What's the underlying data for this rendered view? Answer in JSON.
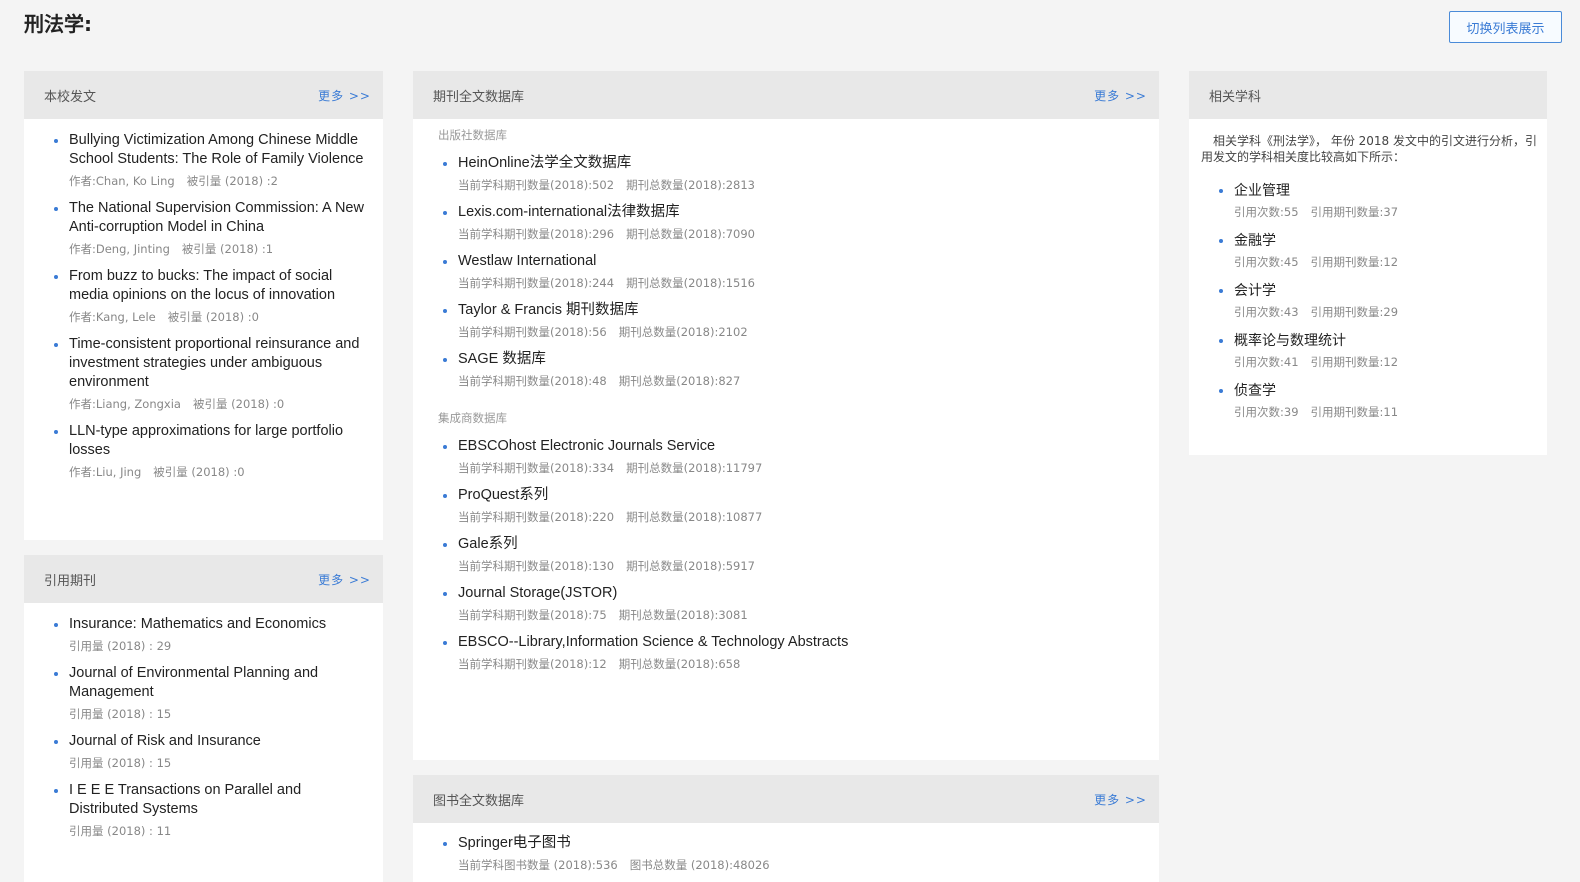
{
  "page": {
    "title": "刑法学:",
    "switch_label": "切换列表展示"
  },
  "school_papers": {
    "title": "本校发文",
    "more": "更多 >>",
    "items": [
      {
        "title": "Bullying Victimization Among Chinese Middle School Students: The Role of Family Violence",
        "author": "作者:Chan, Ko Ling",
        "cited": "被引量 (2018) :2"
      },
      {
        "title": "The National Supervision Commission: A New Anti-corruption Model in China",
        "author": "作者:Deng, Jinting",
        "cited": "被引量 (2018) :1"
      },
      {
        "title": "From buzz to bucks: The impact of social media opinions on the locus of innovation",
        "author": "作者:Kang, Lele",
        "cited": "被引量 (2018) :0"
      },
      {
        "title": "Time-consistent proportional reinsurance and investment strategies under ambiguous environment",
        "author": "作者:Liang, Zongxia",
        "cited": "被引量 (2018) :0"
      },
      {
        "title": "LLN-type approximations for large portfolio losses",
        "author": "作者:Liu, Jing",
        "cited": "被引量 (2018) :0"
      }
    ]
  },
  "cited_journals": {
    "title": "引用期刊",
    "more": "更多 >>",
    "items": [
      {
        "title": "Insurance: Mathematics and Economics",
        "count": "引用量 (2018) : 29"
      },
      {
        "title": "Journal of Environmental Planning and Management",
        "count": "引用量 (2018) : 15"
      },
      {
        "title": "Journal of Risk and Insurance",
        "count": "引用量 (2018) : 15"
      },
      {
        "title": "I E E E Transactions on Parallel and Distributed Systems",
        "count": "引用量 (2018) : 11"
      }
    ]
  },
  "journal_db": {
    "title": "期刊全文数据库",
    "more": "更多 >>",
    "publisher_label": "出版社数据库",
    "publisher_items": [
      {
        "title": "HeinOnline法学全文数据库",
        "current": "当前学科期刊数量(2018):502",
        "total": "期刊总数量(2018):2813"
      },
      {
        "title": "Lexis.com-international法律数据库",
        "current": "当前学科期刊数量(2018):296",
        "total": "期刊总数量(2018):7090"
      },
      {
        "title": "Westlaw International",
        "current": "当前学科期刊数量(2018):244",
        "total": "期刊总数量(2018):1516"
      },
      {
        "title": "Taylor & Francis 期刊数据库",
        "current": "当前学科期刊数量(2018):56",
        "total": "期刊总数量(2018):2102"
      },
      {
        "title": "SAGE 数据库",
        "current": "当前学科期刊数量(2018):48",
        "total": "期刊总数量(2018):827"
      }
    ],
    "aggregator_label": "集成商数据库",
    "aggregator_items": [
      {
        "title": "EBSCOhost Electronic Journals Service",
        "current": "当前学科期刊数量(2018):334",
        "total": "期刊总数量(2018):11797"
      },
      {
        "title": "ProQuest系列",
        "current": "当前学科期刊数量(2018):220",
        "total": "期刊总数量(2018):10877"
      },
      {
        "title": "Gale系列",
        "current": "当前学科期刊数量(2018):130",
        "total": "期刊总数量(2018):5917"
      },
      {
        "title": "Journal Storage(JSTOR)",
        "current": "当前学科期刊数量(2018):75",
        "total": "期刊总数量(2018):3081"
      },
      {
        "title": "EBSCO--Library,Information Science & Technology Abstracts",
        "current": "当前学科期刊数量(2018):12",
        "total": "期刊总数量(2018):658"
      }
    ]
  },
  "book_db": {
    "title": "图书全文数据库",
    "more": "更多 >>",
    "items": [
      {
        "title": "Springer电子图书",
        "current": "当前学科图书数量 (2018):536",
        "total": "图书总数量 (2018):48026"
      }
    ]
  },
  "related_subjects": {
    "title": "相关学科",
    "intro": "相关学科《刑法学》， 年份 2018 发文中的引文进行分析，引用发文的学科相关度比较高如下所示：",
    "items": [
      {
        "title": "企业管理",
        "cites": "引用次数:55",
        "journals": "引用期刊数量:37"
      },
      {
        "title": "金融学",
        "cites": "引用次数:45",
        "journals": "引用期刊数量:12"
      },
      {
        "title": "会计学",
        "cites": "引用次数:43",
        "journals": "引用期刊数量:29"
      },
      {
        "title": "概率论与数理统计",
        "cites": "引用次数:41",
        "journals": "引用期刊数量:12"
      },
      {
        "title": "侦查学",
        "cites": "引用次数:39",
        "journals": "引用期刊数量:11"
      }
    ]
  }
}
